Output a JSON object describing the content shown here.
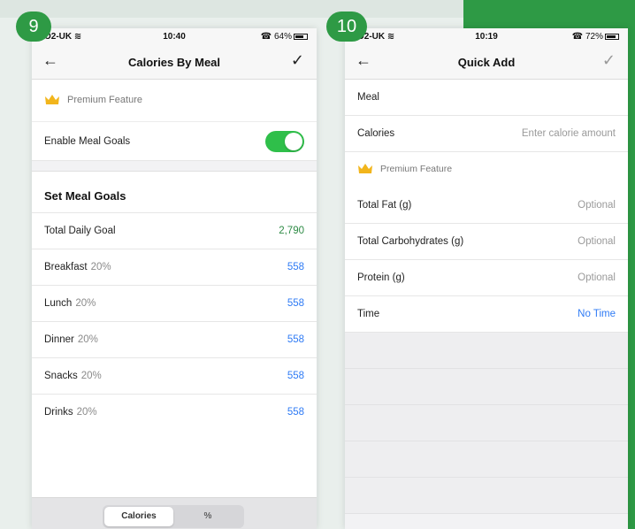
{
  "colors": {
    "accent_green": "#2e9a45",
    "link_blue": "#2f7bf5",
    "toggle_green": "#2fbf4a"
  },
  "steps": {
    "left": "9",
    "right": "10"
  },
  "left_screen": {
    "status": {
      "carrier": "O2-UK",
      "time": "10:40",
      "battery": "64%"
    },
    "title": "Calories By Meal",
    "premium_label": "Premium Feature",
    "enable_label": "Enable Meal Goals",
    "enable_on": true,
    "section_title": "Set Meal Goals",
    "total": {
      "label": "Total Daily Goal",
      "value": "2,790"
    },
    "meals": [
      {
        "name": "Breakfast",
        "pct": "20%",
        "value": "558"
      },
      {
        "name": "Lunch",
        "pct": "20%",
        "value": "558"
      },
      {
        "name": "Dinner",
        "pct": "20%",
        "value": "558"
      },
      {
        "name": "Snacks",
        "pct": "20%",
        "value": "558"
      },
      {
        "name": "Drinks",
        "pct": "20%",
        "value": "558"
      }
    ],
    "segments": {
      "left": "Calories",
      "right": "%",
      "selected": "Calories"
    }
  },
  "right_screen": {
    "status": {
      "carrier": "O2-UK",
      "time": "10:19",
      "battery": "72%"
    },
    "title": "Quick Add",
    "meal_label": "Meal",
    "calories": {
      "label": "Calories",
      "placeholder": "Enter calorie amount"
    },
    "premium_label": "Premium Feature",
    "fields": [
      {
        "label": "Total Fat (g)",
        "placeholder": "Optional"
      },
      {
        "label": "Total Carbohydrates (g)",
        "placeholder": "Optional"
      },
      {
        "label": "Protein (g)",
        "placeholder": "Optional"
      }
    ],
    "time": {
      "label": "Time",
      "value": "No Time"
    }
  }
}
